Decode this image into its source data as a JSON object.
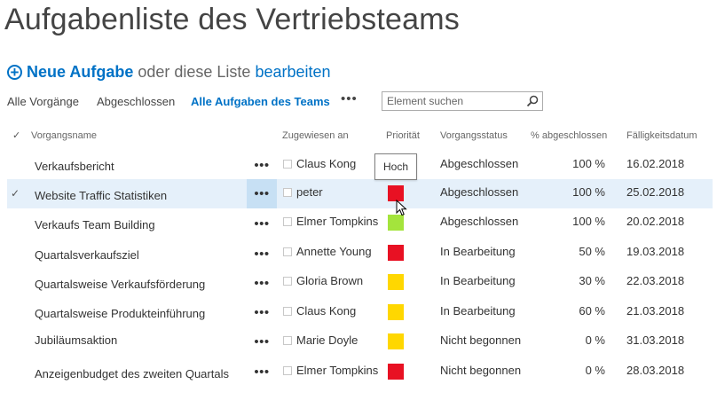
{
  "page": {
    "title": "Aufgabenliste des Vertriebsteams"
  },
  "actions": {
    "new_task": "Neue Aufgabe",
    "or_text": "oder diese Liste",
    "edit": "bearbeiten"
  },
  "views": {
    "all": "Alle Vorgänge",
    "completed": "Abgeschlossen",
    "team": "Alle Aufgaben des Teams",
    "more": "•••"
  },
  "search": {
    "placeholder": "Element suchen"
  },
  "columns": {
    "check": "✓",
    "name": "Vorgangsname",
    "assigned": "Zugewiesen an",
    "priority": "Priorität",
    "status": "Vorgangsstatus",
    "percent": "% abgeschlossen",
    "due": "Fälligkeitsdatum"
  },
  "colors": {
    "accent": "#0072c6",
    "priority_high": "#e81123",
    "priority_normal": "#ffd700",
    "priority_low": "#a4e43c"
  },
  "tooltip": {
    "text": "Hoch"
  },
  "rows": [
    {
      "name": "Verkaufsbericht",
      "ellipsis": "•••",
      "assignee": "Claus Kong",
      "priority": "high",
      "status": "Abgeschlossen",
      "percent": "100 %",
      "due": "16.02.2018",
      "selected": false
    },
    {
      "name": "Website Traffic Statistiken",
      "ellipsis": "•••",
      "assignee": "peter",
      "priority": "high",
      "status": "Abgeschlossen",
      "percent": "100 %",
      "due": "25.02.2018",
      "selected": true,
      "check": "✓"
    },
    {
      "name": "Verkaufs Team Building",
      "ellipsis": "•••",
      "assignee": "Elmer Tompkins",
      "priority": "low",
      "status": "Abgeschlossen",
      "percent": "100 %",
      "due": "20.02.2018",
      "selected": false
    },
    {
      "name": "Quartalsverkaufsziel",
      "ellipsis": "•••",
      "assignee": "Annette Young",
      "priority": "high",
      "status": "In Bearbeitung",
      "percent": "50 %",
      "due": "19.03.2018",
      "selected": false
    },
    {
      "name": "Quartalsweise Verkaufsförderung",
      "ellipsis": "•••",
      "assignee": "Gloria Brown",
      "priority": "normal",
      "status": "In Bearbeitung",
      "percent": "30 %",
      "due": "22.03.2018",
      "selected": false
    },
    {
      "name": "Quartalsweise Produkteinführung",
      "ellipsis": "•••",
      "assignee": "Claus Kong",
      "priority": "normal",
      "status": "In Bearbeitung",
      "percent": "60 %",
      "due": "21.03.2018",
      "selected": false
    },
    {
      "name": "Jubiläumsaktion",
      "ellipsis": "•••",
      "assignee": "Marie Doyle",
      "priority": "normal",
      "status": "Nicht begonnen",
      "percent": "0 %",
      "due": "31.03.2018",
      "selected": false
    },
    {
      "name": "Anzeigenbudget des zweiten Quartals",
      "ellipsis": "•••",
      "assignee": "Elmer Tompkins",
      "priority": "high",
      "status": "Nicht begonnen",
      "percent": "0 %",
      "due": "28.03.2018",
      "selected": false
    }
  ]
}
